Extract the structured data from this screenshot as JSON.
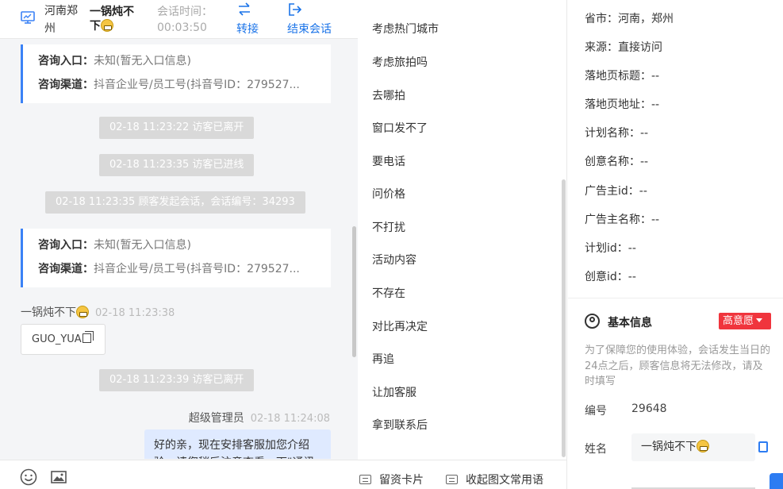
{
  "header": {
    "location": "河南郑州",
    "visitor_name": "一锅炖不下",
    "time_label": "会话时间：",
    "time_value": "00:03:50",
    "transfer_label": "转接",
    "end_label": "结束会话",
    "accent_color": "#1a73e8"
  },
  "chat": {
    "cards": [
      {
        "entry_label": "咨询入口：",
        "entry_value": "未知(暂无入口信息)",
        "channel_label": "咨询渠道：",
        "channel_value": "抖音企业号/员工号(抖音号ID：279527..."
      },
      {
        "entry_label": "咨询入口：",
        "entry_value": "未知(暂无入口信息)",
        "channel_label": "咨询渠道：",
        "channel_value": "抖音企业号/员工号(抖音号ID：279527..."
      }
    ],
    "system_messages": [
      "02-18 11:23:22 访客已离开",
      "02-18 11:23:35 访客已进线",
      "02-18 11:23:35 顾客发起会话，会话编号：34293",
      "02-18 11:23:39 访客已离开"
    ],
    "visitor_message": {
      "sender": "一锅炖不下",
      "time": "02-18 11:23:38",
      "text": "GUO_YUA"
    },
    "agent_message": {
      "sender": "超级管理员",
      "time": "02-18 11:24:08",
      "text": "好的亲，现在安排客服加您介绍验，请您稍后注意查看一下\"通讯"
    }
  },
  "phrases": {
    "items": [
      "考虑热门城市",
      "考虑旅拍吗",
      "去哪拍",
      "窗口发不了",
      "要电话",
      "问价格",
      "不打扰",
      "活动内容",
      "不存在",
      "对比再决定",
      "再追",
      "让加客服",
      "拿到联系后"
    ],
    "footer_card": "留资卡片",
    "footer_collapse": "收起图文常用语"
  },
  "visitor_info": {
    "fields": [
      {
        "label": "省市：",
        "value": "河南，郑州"
      },
      {
        "label": "来源：",
        "value": "直接访问"
      },
      {
        "label": "落地页标题：",
        "value": "--"
      },
      {
        "label": "落地页地址：",
        "value": "--"
      },
      {
        "label": "计划名称：",
        "value": "--"
      },
      {
        "label": "创意名称：",
        "value": "--"
      },
      {
        "label": "广告主id：",
        "value": "--"
      },
      {
        "label": "广告主名称：",
        "value": "--"
      },
      {
        "label": "计划id：",
        "value": "--"
      },
      {
        "label": "创意id：",
        "value": "--"
      }
    ],
    "section_title": "基本信息",
    "intent_tag": "高意愿",
    "intent_color": "#f0353d",
    "notice": "为了保障您的使用体验，会话发生当日的24点之后，顾客信息将无法修改，请及时填写",
    "id_label": "编号",
    "id_value": "29648",
    "name_label": "姓名",
    "name_value": "一锅炖不下"
  }
}
